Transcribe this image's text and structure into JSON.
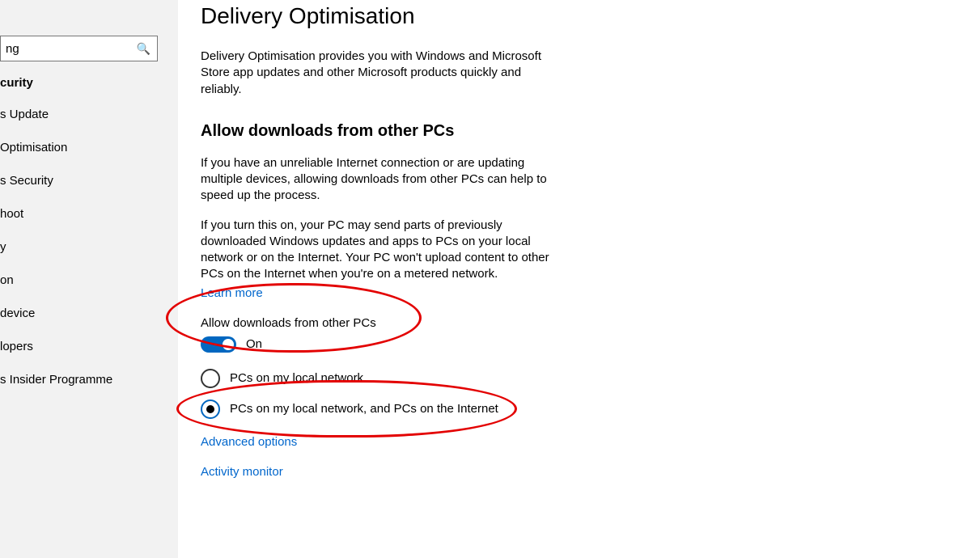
{
  "sidebar": {
    "search_placeholder": "ng",
    "heading": "curity",
    "items": [
      "s Update",
      "Optimisation",
      "s Security",
      "hoot",
      "y",
      "on",
      "device",
      "lopers",
      "s Insider Programme"
    ]
  },
  "main": {
    "title": "Delivery Optimisation",
    "intro": "Delivery Optimisation provides you with Windows and Microsoft Store app updates and other Microsoft products quickly and reliably.",
    "section_heading": "Allow downloads from other PCs",
    "para1": "If you have an unreliable Internet connection or are updating multiple devices, allowing downloads from other PCs can help to speed up the process.",
    "para2": "If you turn this on, your PC may send parts of previously downloaded Windows updates and apps to PCs on your local network or on the Internet. Your PC won't upload content to other PCs on the Internet when you're on a metered network.",
    "learn_more": "Learn more",
    "toggle_label": "Allow downloads from other PCs",
    "toggle_state": "On",
    "radio1": "PCs on my local network",
    "radio2": "PCs on my local network, and PCs on the Internet",
    "advanced": "Advanced options",
    "activity": "Activity monitor"
  }
}
